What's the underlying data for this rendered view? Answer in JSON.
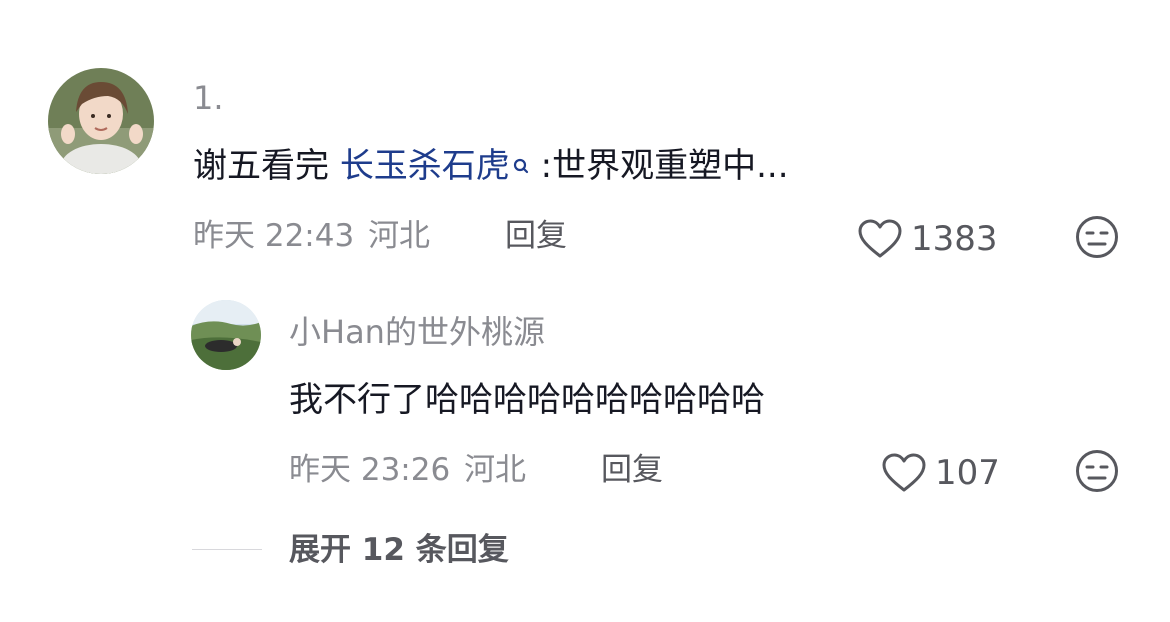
{
  "comment": {
    "username": "1.",
    "text_prefix": "谢五看完 ",
    "mention": "长玉杀石虎",
    "text_suffix": " :世界观重塑中...",
    "time": "昨天 22:43",
    "location": "河北",
    "reply_label": "回复",
    "likes": "1383",
    "like_icon": "heart-outline-icon",
    "dislike_icon": "meh-face-icon"
  },
  "reply": {
    "username": "小Han的世外桃源",
    "text": "我不行了哈哈哈哈哈哈哈哈哈哈",
    "time": "昨天 23:26",
    "location": "河北",
    "reply_label": "回复",
    "likes": "107",
    "like_icon": "heart-outline-icon",
    "dislike_icon": "meh-face-icon"
  },
  "expand": {
    "label": "展开 12 条回复"
  },
  "colors": {
    "text_primary": "#161823",
    "text_secondary": "#8a8b91",
    "mention": "#1e3c8c",
    "action": "#57585e"
  }
}
